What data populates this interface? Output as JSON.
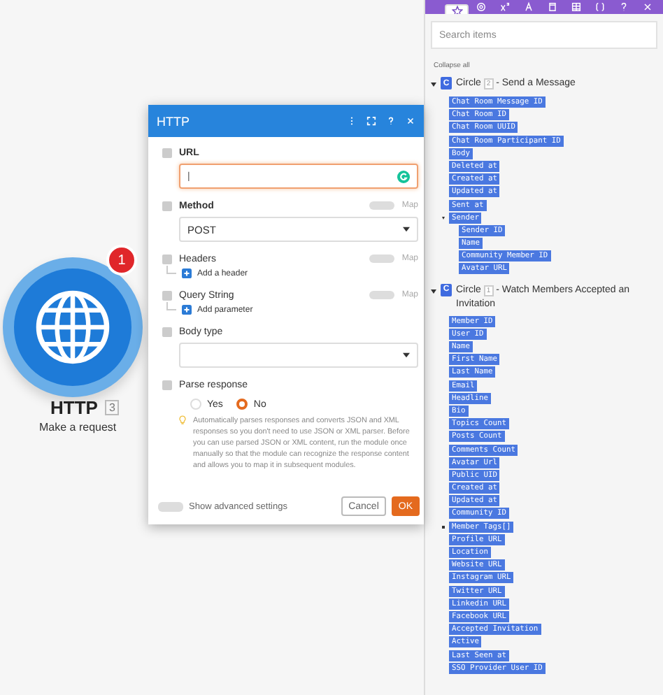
{
  "node": {
    "title": "HTTP",
    "number": "3",
    "subtitle": "Make a request",
    "badge": "1"
  },
  "dialog": {
    "title": "HTTP",
    "fields": [
      {
        "kind": "input",
        "label": "URL",
        "value": "|",
        "focused": true,
        "checked": false
      },
      {
        "kind": "select",
        "label": "Method",
        "value": "POST",
        "map": "Map",
        "map_on": false,
        "checked": false
      },
      {
        "kind": "list",
        "label": "Headers",
        "add": "Add a header",
        "map": "Map",
        "map_on": false,
        "checked": false
      },
      {
        "kind": "list",
        "label": "Query String",
        "add": "Add parameter",
        "map": "Map",
        "map_on": false,
        "checked": false
      },
      {
        "kind": "select",
        "label": "Body type",
        "checked": false
      },
      {
        "kind": "radio",
        "label": "Parse response",
        "checked": false,
        "options": [
          {
            "label": "Yes",
            "selected": false
          },
          {
            "label": "No",
            "selected": true
          }
        ],
        "hint": "Automatically parses responses and converts JSON and XML responses so you don't need to use JSON or XML parser. Before you can use parsed JSON or XML content, run the module once manually so that the module can recognize the response content and allows you to map it in subsequent modules."
      }
    ],
    "advanced": {
      "label": "Show advanced settings",
      "on": false
    },
    "buttons": [
      {
        "label": "Cancel",
        "kind": "secondary"
      },
      {
        "label": "OK",
        "kind": "primary"
      }
    ]
  },
  "panel": {
    "tabs": [
      {
        "selected": true
      },
      {
        "selected": false
      },
      {
        "selected": false
      },
      {
        "selected": false
      },
      {
        "selected": false
      },
      {
        "selected": false
      },
      {
        "selected": false
      },
      {
        "selected": false
      },
      {
        "selected": false
      }
    ],
    "search": {
      "placeholder": "Search items"
    },
    "collapse": "Collapse all",
    "sections": [
      {
        "app_icon": "C",
        "app": "Circle",
        "number": "2",
        "title": "- Send a Message",
        "items": [
          {
            "kind": "field",
            "label": "Chat Room Message ID"
          },
          {
            "kind": "field",
            "label": "Chat Room ID"
          },
          {
            "kind": "field",
            "label": "Chat Room UUID"
          },
          {
            "kind": "field",
            "label": "Chat Room Participant ID"
          },
          {
            "kind": "field",
            "label": "Body"
          },
          {
            "kind": "field",
            "label": "Deleted at"
          },
          {
            "kind": "field",
            "label": "Created at"
          },
          {
            "kind": "field",
            "label": "Updated at"
          },
          {
            "kind": "field",
            "label": "Sent at"
          },
          {
            "kind": "collection",
            "label": "Sender",
            "expanded": true,
            "children": [
              {
                "kind": "field",
                "label": "Sender ID"
              },
              {
                "kind": "field",
                "label": "Name"
              },
              {
                "kind": "field",
                "label": "Community Member ID"
              },
              {
                "kind": "field",
                "label": "Avatar URL"
              }
            ]
          }
        ]
      },
      {
        "app_icon": "C",
        "app": "Circle",
        "number": "1",
        "title": "- Watch Members Accepted an Invitation",
        "items": [
          {
            "kind": "field",
            "label": "Member ID"
          },
          {
            "kind": "field",
            "label": "User ID"
          },
          {
            "kind": "field",
            "label": "Name"
          },
          {
            "kind": "field",
            "label": "First Name"
          },
          {
            "kind": "field",
            "label": "Last Name"
          },
          {
            "kind": "field",
            "label": "Email"
          },
          {
            "kind": "field",
            "label": "Headline"
          },
          {
            "kind": "field",
            "label": "Bio"
          },
          {
            "kind": "field",
            "label": "Topics Count"
          },
          {
            "kind": "field",
            "label": "Posts Count"
          },
          {
            "kind": "field",
            "label": "Comments Count"
          },
          {
            "kind": "field",
            "label": "Avatar Url"
          },
          {
            "kind": "field",
            "label": "Public UID"
          },
          {
            "kind": "field",
            "label": "Created at"
          },
          {
            "kind": "field",
            "label": "Updated at"
          },
          {
            "kind": "field",
            "label": "Community ID"
          },
          {
            "kind": "collection",
            "label": "Member Tags[]",
            "expanded": false
          },
          {
            "kind": "field",
            "label": "Profile URL"
          },
          {
            "kind": "field",
            "label": "Location"
          },
          {
            "kind": "field",
            "label": "Website URL"
          },
          {
            "kind": "field",
            "label": "Instagram URL"
          },
          {
            "kind": "field",
            "label": "Twitter URL"
          },
          {
            "kind": "field",
            "label": "Linkedin URL"
          },
          {
            "kind": "field",
            "label": "Facebook URL"
          },
          {
            "kind": "field",
            "label": "Accepted Invitation"
          },
          {
            "kind": "field",
            "label": "Active"
          },
          {
            "kind": "field",
            "label": "Last Seen at"
          },
          {
            "kind": "field",
            "label": "SSO Provider User ID"
          }
        ]
      }
    ]
  }
}
